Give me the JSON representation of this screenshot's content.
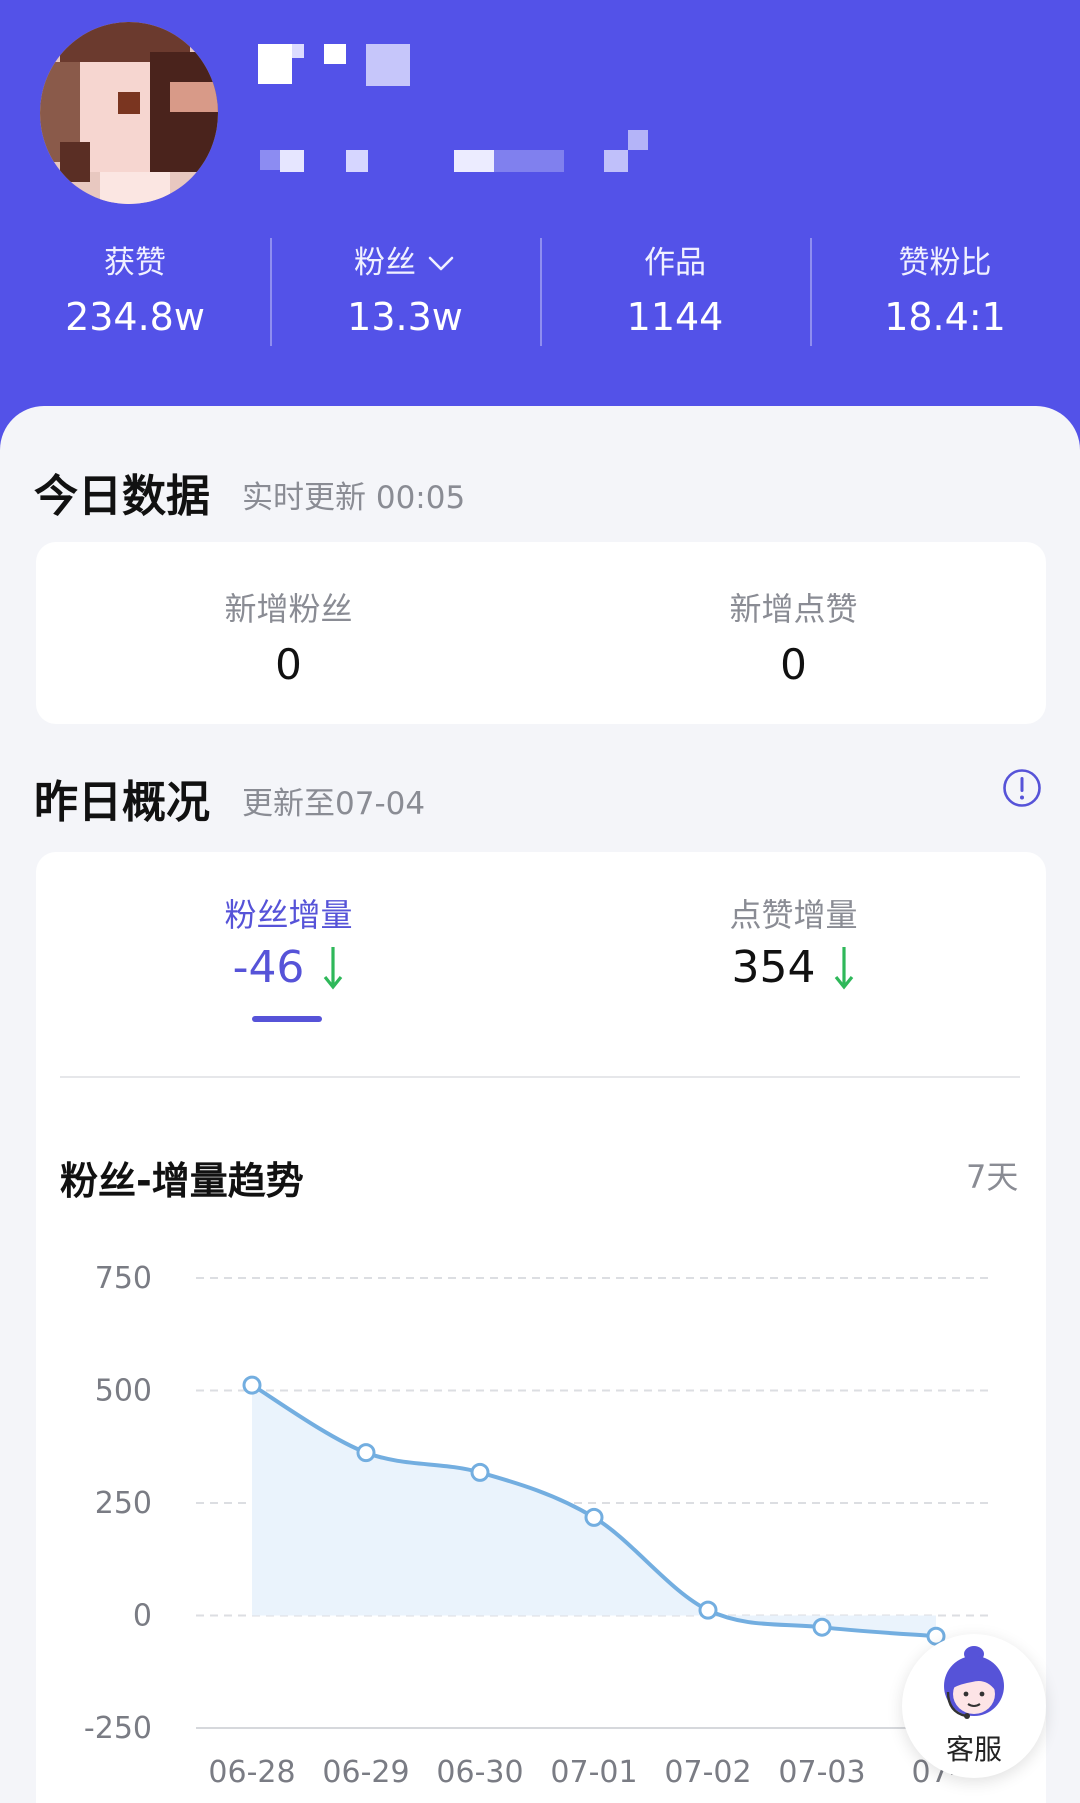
{
  "profile": {
    "stats": [
      {
        "label": "获赞",
        "value": "234.8w"
      },
      {
        "label": "粉丝",
        "value": "13.3w"
      },
      {
        "label": "作品",
        "value": "1144"
      },
      {
        "label": "赞粉比",
        "value": "18.4:1"
      }
    ]
  },
  "today": {
    "title": "今日数据",
    "subtitle": "实时更新 00:05",
    "cells": [
      {
        "label": "新增粉丝",
        "value": "0"
      },
      {
        "label": "新增点赞",
        "value": "0"
      }
    ]
  },
  "yesterday": {
    "title": "昨日概况",
    "subtitle": "更新至07-04",
    "metrics": [
      {
        "label": "粉丝增量",
        "value": "-46"
      },
      {
        "label": "点赞增量",
        "value": "354"
      }
    ]
  },
  "trend": {
    "title": "粉丝-增量趋势",
    "range": "7天"
  },
  "customer_service": {
    "label": "客服"
  },
  "colors": {
    "header": "#5352e8",
    "accent": "#5653d8",
    "down_arrow": "#2fb85a",
    "line": "#73aee0",
    "fill": "#eaf3fc"
  },
  "chart_data": {
    "type": "area",
    "title": "粉丝-增量趋势",
    "x": [
      "06-28",
      "06-29",
      "06-30",
      "07-01",
      "07-02",
      "07-03",
      "07-04"
    ],
    "x_tick_labels": [
      "06-28",
      "06-29",
      "06-30",
      "07-01",
      "07-02",
      "07-03",
      "07-"
    ],
    "series": [
      {
        "values": [
          512,
          362,
          318,
          218,
          12,
          -26,
          -46
        ]
      }
    ],
    "yticks": [
      750,
      500,
      250,
      0,
      -250
    ],
    "ylim": [
      -250,
      750
    ],
    "grid": true,
    "legend": "none"
  }
}
